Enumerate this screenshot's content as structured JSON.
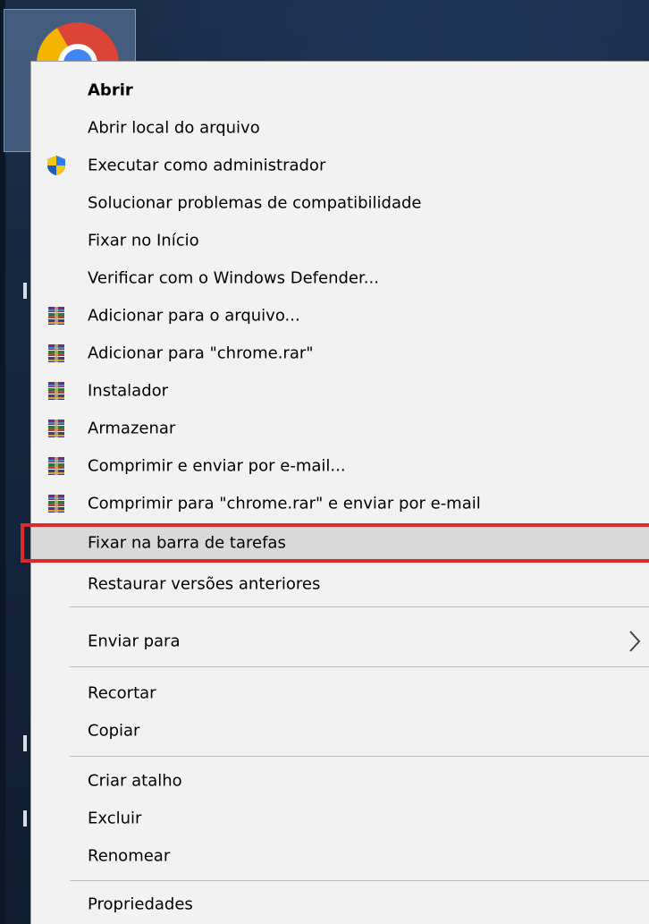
{
  "desktop": {
    "shortcut_icon": "chrome-icon"
  },
  "menu": {
    "items": [
      {
        "label": "Abrir",
        "bold": true
      },
      {
        "label": "Abrir local do arquivo"
      },
      {
        "label": "Executar como administrador",
        "icon": "uac-shield-icon"
      },
      {
        "label": "Solucionar problemas de compatibilidade"
      },
      {
        "label": "Fixar no Início"
      },
      {
        "label": "Verificar com o Windows Defender..."
      },
      {
        "label": "Adicionar para o arquivo...",
        "icon": "winrar-icon"
      },
      {
        "label": "Adicionar para \"chrome.rar\"",
        "icon": "winrar-icon"
      },
      {
        "label": "Instalador",
        "icon": "winrar-icon"
      },
      {
        "label": "Armazenar",
        "icon": "winrar-icon"
      },
      {
        "label": "Comprimir e enviar por e-mail...",
        "icon": "winrar-icon"
      },
      {
        "label": "Comprimir para \"chrome.rar\" e enviar por e-mail",
        "icon": "winrar-icon"
      },
      {
        "label": "Fixar na barra de tarefas",
        "highlighted": true
      },
      {
        "label": "Restaurar versões anteriores"
      },
      {
        "label": "Enviar para",
        "submenu_icon": "chevron-right-icon"
      },
      {
        "label": "Recortar"
      },
      {
        "label": "Copiar"
      },
      {
        "label": "Criar atalho"
      },
      {
        "label": "Excluir"
      },
      {
        "label": "Renomear"
      },
      {
        "label": "Propriedades"
      }
    ]
  },
  "colors": {
    "menu_bg": "#f2f2f2",
    "hover_bg": "#d9d9d9",
    "annotation_red": "#e0272e",
    "desktop_bg": "#14243a"
  }
}
